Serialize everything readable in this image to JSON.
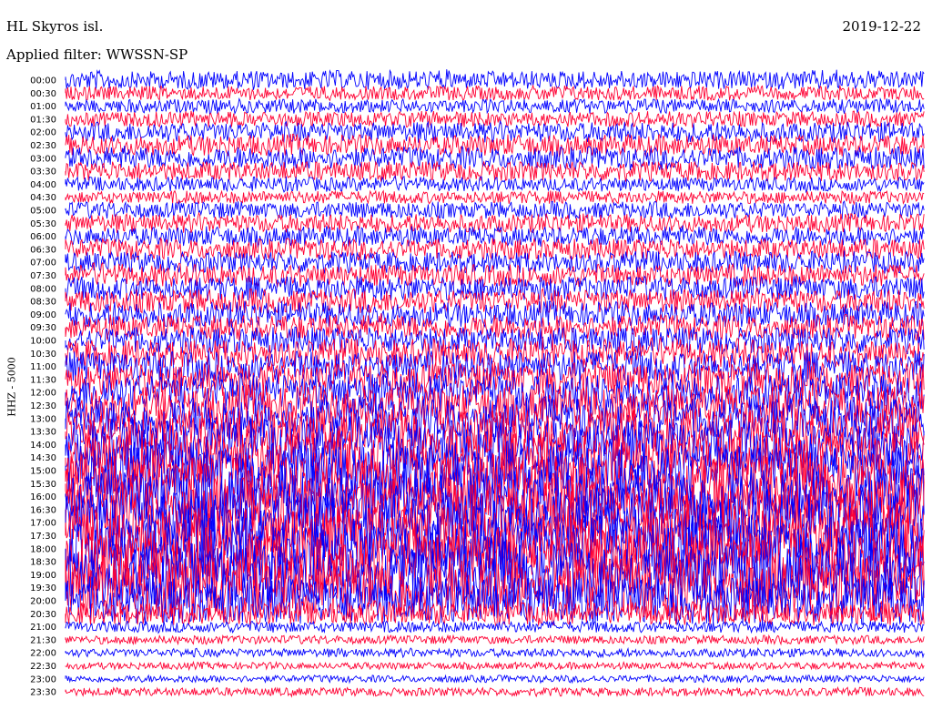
{
  "header": {
    "station": "HL Skyros isl.",
    "date": "2019-12-22",
    "filter": "Applied filter: WWSSN-SP"
  },
  "channel_label": "HHZ - 5000",
  "colors": {
    "trace_a": "#0000ff",
    "trace_b": "#ff0033",
    "background": "#ffffff"
  },
  "chart_data": {
    "type": "helicorder",
    "title": "HL Skyros isl.",
    "subtitle": "Applied filter: WWSSN-SP",
    "ylabel": "HHZ - 5000",
    "time_labels": [
      "00:00",
      "00:30",
      "01:00",
      "01:30",
      "02:00",
      "02:30",
      "03:00",
      "03:30",
      "04:00",
      "04:30",
      "05:00",
      "05:30",
      "06:00",
      "06:30",
      "07:00",
      "07:30",
      "08:00",
      "08:30",
      "09:00",
      "09:30",
      "10:00",
      "10:30",
      "11:00",
      "11:30",
      "12:00",
      "12:30",
      "13:00",
      "13:30",
      "14:00",
      "14:30",
      "15:00",
      "15:30",
      "16:00",
      "16:30",
      "17:00",
      "17:30",
      "18:00",
      "18:30",
      "19:00",
      "19:30",
      "20:00",
      "20:30",
      "21:00",
      "21:30",
      "22:00",
      "22:30",
      "23:00",
      "23:30"
    ],
    "trace_colors_alternating": [
      "#0000ff",
      "#ff0033"
    ],
    "relative_amplitude": [
      1.3,
      1.0,
      1.0,
      1.1,
      1.4,
      1.5,
      1.6,
      1.4,
      1.0,
      0.9,
      1.2,
      1.3,
      1.4,
      1.5,
      1.5,
      1.6,
      1.7,
      1.7,
      1.8,
      1.8,
      1.9,
      2.0,
      2.2,
      2.4,
      2.6,
      2.8,
      3.0,
      3.2,
      3.6,
      3.8,
      4.0,
      4.2,
      4.3,
      4.4,
      4.5,
      4.5,
      4.6,
      4.6,
      4.5,
      4.4,
      3.4,
      1.6,
      0.8,
      0.6,
      0.6,
      0.5,
      0.5,
      0.6
    ],
    "grid": false
  }
}
